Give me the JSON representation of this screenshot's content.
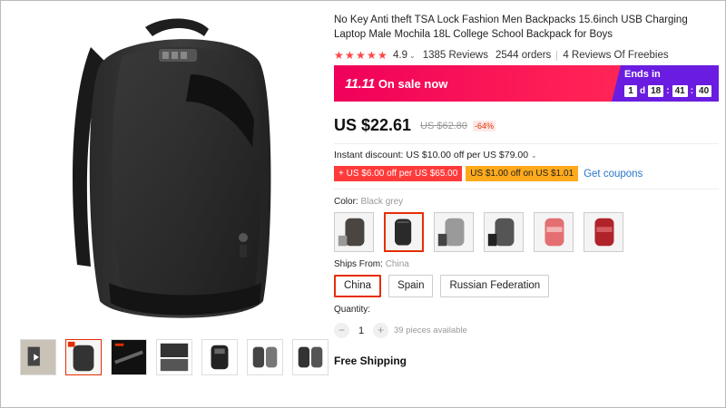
{
  "product": {
    "title": "No Key Anti theft TSA Lock Fashion Men Backpacks 15.6inch USB Charging Laptop Male Mochila 18L College School Backpack for Boys",
    "rating": "4.9",
    "reviews": "1385 Reviews",
    "orders": "2544 orders",
    "freebies": "4 Reviews Of Freebies"
  },
  "sale": {
    "brand": "11.11",
    "label": "On sale now",
    "ends_in": "Ends in",
    "days": "1",
    "days_label": "d",
    "hours": "18",
    "minutes": "41",
    "seconds": "40"
  },
  "price": {
    "current": "US $22.61",
    "original": "US $62.80",
    "discount": "-64%"
  },
  "instant_discount": "Instant discount: US $10.00 off per US $79.00",
  "coupons": {
    "store": "+ US $6.00 off per US $65.00",
    "select": "US $1.00 off on US $1.01",
    "link": "Get coupons"
  },
  "color": {
    "label": "Color:",
    "selected": "Black grey",
    "swatches": [
      "dark-brown-grey",
      "black-grey",
      "light-grey",
      "charcoal",
      "pink",
      "red"
    ]
  },
  "ships_from": {
    "label": "Ships From:",
    "selected": "China",
    "options": [
      "China",
      "Spain",
      "Russian Federation"
    ]
  },
  "quantity": {
    "label": "Quantity:",
    "minus": "−",
    "value": "1",
    "plus": "+",
    "available": "39 pieces available"
  },
  "shipping": "Free Shipping",
  "colors": {
    "accent": "#e62e04",
    "sale_pink": "#ff1f56",
    "countdown_purple": "#6a1de0",
    "star": "#ff4444",
    "link": "#2a76c9",
    "coupon_red": "#ff3a3a",
    "coupon_orange": "#ffaa1c"
  }
}
